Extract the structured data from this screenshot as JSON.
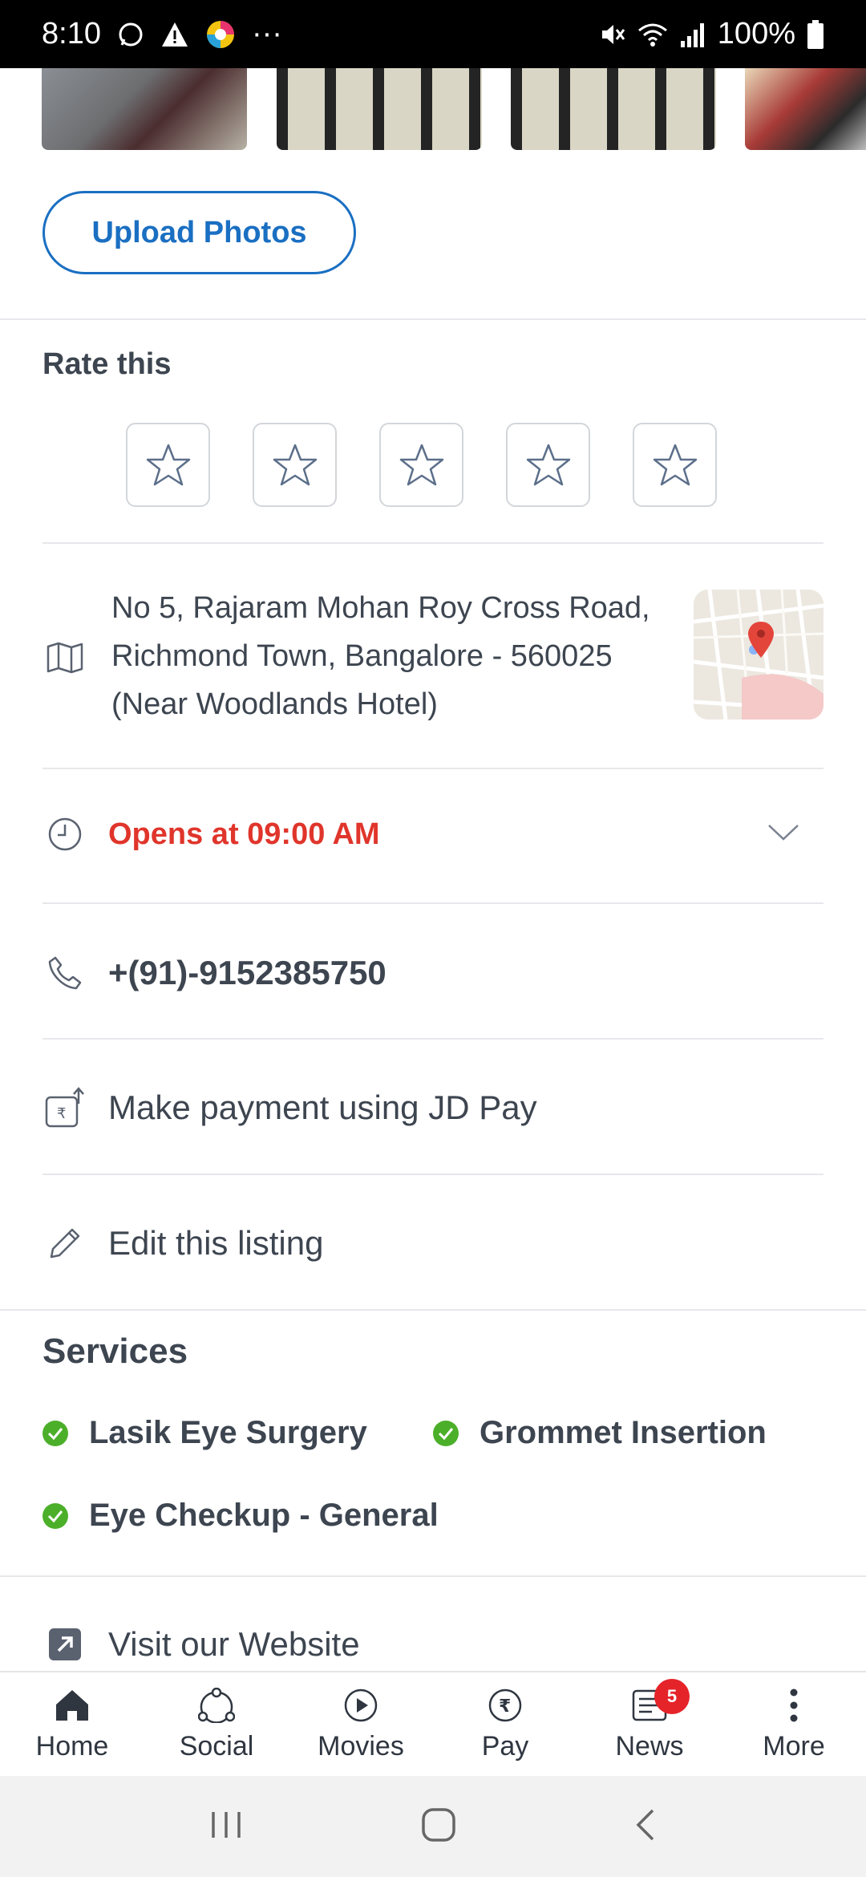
{
  "status_bar": {
    "time": "8:10",
    "battery": "100%",
    "dots": "···"
  },
  "photos": {
    "items": [
      {
        "alt": "parking-photo"
      },
      {
        "alt": "interior-seating-photo"
      },
      {
        "alt": "interior-seating-photo"
      },
      {
        "alt": "street-photo"
      }
    ]
  },
  "upload": {
    "label": "Upload Photos"
  },
  "rating": {
    "title": "Rate this",
    "stars": 5,
    "selected": 0
  },
  "address": {
    "line1": "No 5, Rajaram Mohan Roy Cross Road,",
    "line2": "Richmond Town, Bangalore - 560025",
    "line3": "(Near Woodlands Hotel)"
  },
  "hours": {
    "text": "Opens at 09:00 AM"
  },
  "phone": {
    "number": "+(91)-9152385750"
  },
  "payment": {
    "text": "Make payment using JD Pay"
  },
  "edit": {
    "text": "Edit this listing"
  },
  "services": {
    "title": "Services",
    "items": [
      "Lasik Eye Surgery",
      "Grommet Insertion",
      "Eye Checkup - General"
    ]
  },
  "website": {
    "text": "Visit our Website"
  },
  "bottom_nav": {
    "items": [
      {
        "label": "Home"
      },
      {
        "label": "Social"
      },
      {
        "label": "Movies"
      },
      {
        "label": "Pay"
      },
      {
        "label": "News",
        "badge": "5"
      },
      {
        "label": "More"
      }
    ]
  },
  "colors": {
    "accent": "#1a6fc2",
    "hours_red": "#e0352b",
    "check_green": "#4caf2a",
    "badge_red": "#e5242a"
  }
}
